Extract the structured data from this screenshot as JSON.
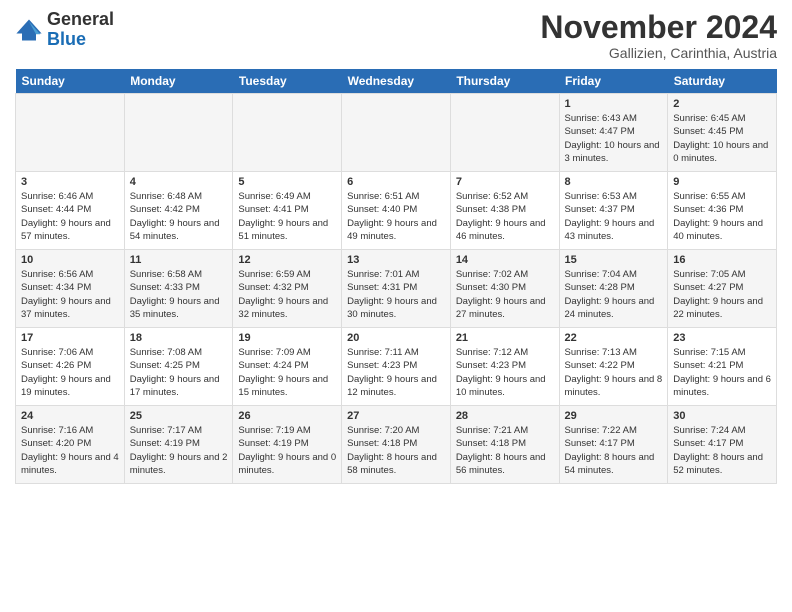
{
  "logo": {
    "general": "General",
    "blue": "Blue"
  },
  "header": {
    "month": "November 2024",
    "location": "Gallizien, Carinthia, Austria"
  },
  "weekdays": [
    "Sunday",
    "Monday",
    "Tuesday",
    "Wednesday",
    "Thursday",
    "Friday",
    "Saturday"
  ],
  "weeks": [
    [
      {
        "day": "",
        "sunrise": "",
        "sunset": "",
        "daylight": ""
      },
      {
        "day": "",
        "sunrise": "",
        "sunset": "",
        "daylight": ""
      },
      {
        "day": "",
        "sunrise": "",
        "sunset": "",
        "daylight": ""
      },
      {
        "day": "",
        "sunrise": "",
        "sunset": "",
        "daylight": ""
      },
      {
        "day": "",
        "sunrise": "",
        "sunset": "",
        "daylight": ""
      },
      {
        "day": "1",
        "sunrise": "Sunrise: 6:43 AM",
        "sunset": "Sunset: 4:47 PM",
        "daylight": "Daylight: 10 hours and 3 minutes."
      },
      {
        "day": "2",
        "sunrise": "Sunrise: 6:45 AM",
        "sunset": "Sunset: 4:45 PM",
        "daylight": "Daylight: 10 hours and 0 minutes."
      }
    ],
    [
      {
        "day": "3",
        "sunrise": "Sunrise: 6:46 AM",
        "sunset": "Sunset: 4:44 PM",
        "daylight": "Daylight: 9 hours and 57 minutes."
      },
      {
        "day": "4",
        "sunrise": "Sunrise: 6:48 AM",
        "sunset": "Sunset: 4:42 PM",
        "daylight": "Daylight: 9 hours and 54 minutes."
      },
      {
        "day": "5",
        "sunrise": "Sunrise: 6:49 AM",
        "sunset": "Sunset: 4:41 PM",
        "daylight": "Daylight: 9 hours and 51 minutes."
      },
      {
        "day": "6",
        "sunrise": "Sunrise: 6:51 AM",
        "sunset": "Sunset: 4:40 PM",
        "daylight": "Daylight: 9 hours and 49 minutes."
      },
      {
        "day": "7",
        "sunrise": "Sunrise: 6:52 AM",
        "sunset": "Sunset: 4:38 PM",
        "daylight": "Daylight: 9 hours and 46 minutes."
      },
      {
        "day": "8",
        "sunrise": "Sunrise: 6:53 AM",
        "sunset": "Sunset: 4:37 PM",
        "daylight": "Daylight: 9 hours and 43 minutes."
      },
      {
        "day": "9",
        "sunrise": "Sunrise: 6:55 AM",
        "sunset": "Sunset: 4:36 PM",
        "daylight": "Daylight: 9 hours and 40 minutes."
      }
    ],
    [
      {
        "day": "10",
        "sunrise": "Sunrise: 6:56 AM",
        "sunset": "Sunset: 4:34 PM",
        "daylight": "Daylight: 9 hours and 37 minutes."
      },
      {
        "day": "11",
        "sunrise": "Sunrise: 6:58 AM",
        "sunset": "Sunset: 4:33 PM",
        "daylight": "Daylight: 9 hours and 35 minutes."
      },
      {
        "day": "12",
        "sunrise": "Sunrise: 6:59 AM",
        "sunset": "Sunset: 4:32 PM",
        "daylight": "Daylight: 9 hours and 32 minutes."
      },
      {
        "day": "13",
        "sunrise": "Sunrise: 7:01 AM",
        "sunset": "Sunset: 4:31 PM",
        "daylight": "Daylight: 9 hours and 30 minutes."
      },
      {
        "day": "14",
        "sunrise": "Sunrise: 7:02 AM",
        "sunset": "Sunset: 4:30 PM",
        "daylight": "Daylight: 9 hours and 27 minutes."
      },
      {
        "day": "15",
        "sunrise": "Sunrise: 7:04 AM",
        "sunset": "Sunset: 4:28 PM",
        "daylight": "Daylight: 9 hours and 24 minutes."
      },
      {
        "day": "16",
        "sunrise": "Sunrise: 7:05 AM",
        "sunset": "Sunset: 4:27 PM",
        "daylight": "Daylight: 9 hours and 22 minutes."
      }
    ],
    [
      {
        "day": "17",
        "sunrise": "Sunrise: 7:06 AM",
        "sunset": "Sunset: 4:26 PM",
        "daylight": "Daylight: 9 hours and 19 minutes."
      },
      {
        "day": "18",
        "sunrise": "Sunrise: 7:08 AM",
        "sunset": "Sunset: 4:25 PM",
        "daylight": "Daylight: 9 hours and 17 minutes."
      },
      {
        "day": "19",
        "sunrise": "Sunrise: 7:09 AM",
        "sunset": "Sunset: 4:24 PM",
        "daylight": "Daylight: 9 hours and 15 minutes."
      },
      {
        "day": "20",
        "sunrise": "Sunrise: 7:11 AM",
        "sunset": "Sunset: 4:23 PM",
        "daylight": "Daylight: 9 hours and 12 minutes."
      },
      {
        "day": "21",
        "sunrise": "Sunrise: 7:12 AM",
        "sunset": "Sunset: 4:23 PM",
        "daylight": "Daylight: 9 hours and 10 minutes."
      },
      {
        "day": "22",
        "sunrise": "Sunrise: 7:13 AM",
        "sunset": "Sunset: 4:22 PM",
        "daylight": "Daylight: 9 hours and 8 minutes."
      },
      {
        "day": "23",
        "sunrise": "Sunrise: 7:15 AM",
        "sunset": "Sunset: 4:21 PM",
        "daylight": "Daylight: 9 hours and 6 minutes."
      }
    ],
    [
      {
        "day": "24",
        "sunrise": "Sunrise: 7:16 AM",
        "sunset": "Sunset: 4:20 PM",
        "daylight": "Daylight: 9 hours and 4 minutes."
      },
      {
        "day": "25",
        "sunrise": "Sunrise: 7:17 AM",
        "sunset": "Sunset: 4:19 PM",
        "daylight": "Daylight: 9 hours and 2 minutes."
      },
      {
        "day": "26",
        "sunrise": "Sunrise: 7:19 AM",
        "sunset": "Sunset: 4:19 PM",
        "daylight": "Daylight: 9 hours and 0 minutes."
      },
      {
        "day": "27",
        "sunrise": "Sunrise: 7:20 AM",
        "sunset": "Sunset: 4:18 PM",
        "daylight": "Daylight: 8 hours and 58 minutes."
      },
      {
        "day": "28",
        "sunrise": "Sunrise: 7:21 AM",
        "sunset": "Sunset: 4:18 PM",
        "daylight": "Daylight: 8 hours and 56 minutes."
      },
      {
        "day": "29",
        "sunrise": "Sunrise: 7:22 AM",
        "sunset": "Sunset: 4:17 PM",
        "daylight": "Daylight: 8 hours and 54 minutes."
      },
      {
        "day": "30",
        "sunrise": "Sunrise: 7:24 AM",
        "sunset": "Sunset: 4:17 PM",
        "daylight": "Daylight: 8 hours and 52 minutes."
      }
    ]
  ]
}
